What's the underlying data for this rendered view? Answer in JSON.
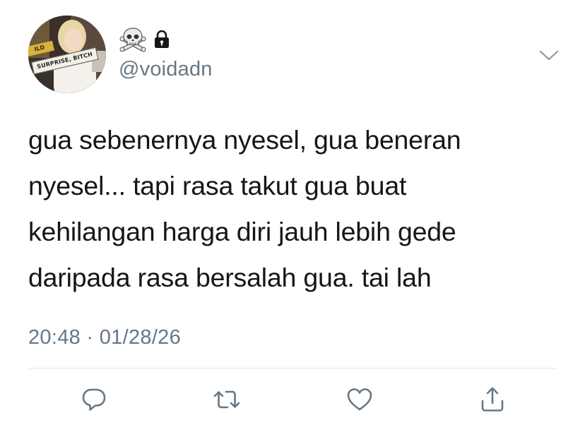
{
  "tweet": {
    "display_name_emoji": [
      "skull-and-crossbones",
      "lock"
    ],
    "handle": "@voidadn",
    "avatar_sign_text": "SURPRISE, BITCH",
    "avatar_top_sign_text": "ILD",
    "text_lines": [
      "gua sebenernya nyesel, gua beneran",
      "nyesel... tapi rasa takut gua buat",
      "kehilangan harga diri jauh lebih gede",
      "daripada rasa bersalah gua. tai lah"
    ],
    "timestamp": "20:48 · 01/28/26"
  },
  "actions": {
    "icons": [
      "reply-icon",
      "retweet-icon",
      "like-icon",
      "share-icon"
    ]
  },
  "colors": {
    "text": "#14171a",
    "secondary": "#657786",
    "icon": "#657786",
    "divider": "#e1e8ed"
  }
}
